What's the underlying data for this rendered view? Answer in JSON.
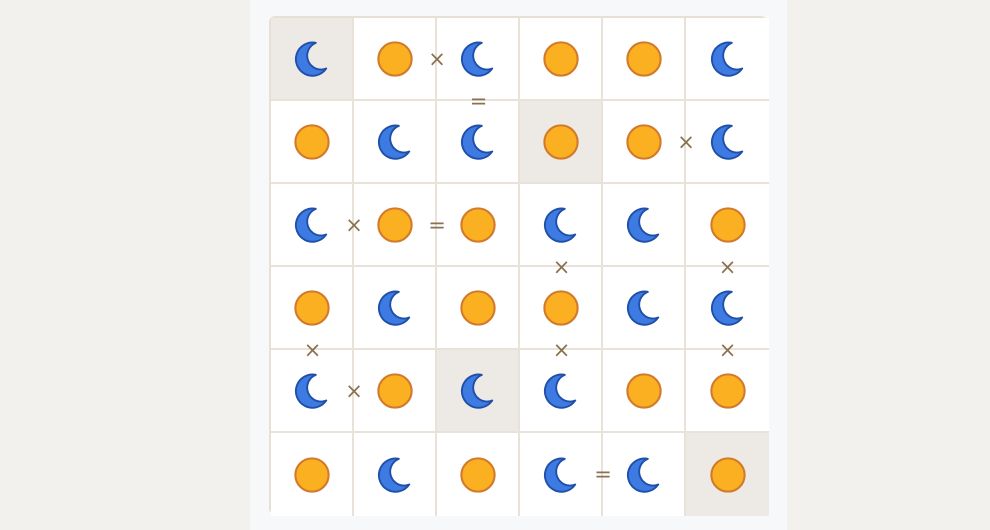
{
  "colors": {
    "sun_fill": "#fbb022",
    "sun_stroke": "#d27a2b",
    "moon_fill": "#3d7be3",
    "moon_stroke": "#1f4fa8",
    "locked_bg": "#ede9e4",
    "constraint": "#8a7150"
  },
  "icons": {
    "sun": "sun-icon",
    "moon": "moon-icon"
  },
  "grid": [
    [
      {
        "v": "moon",
        "locked": true
      },
      {
        "v": "sun",
        "locked": false
      },
      {
        "v": "moon",
        "locked": false
      },
      {
        "v": "sun",
        "locked": false
      },
      {
        "v": "sun",
        "locked": false
      },
      {
        "v": "moon",
        "locked": false
      }
    ],
    [
      {
        "v": "sun",
        "locked": false
      },
      {
        "v": "moon",
        "locked": false
      },
      {
        "v": "moon",
        "locked": false
      },
      {
        "v": "sun",
        "locked": true
      },
      {
        "v": "sun",
        "locked": false
      },
      {
        "v": "moon",
        "locked": false
      }
    ],
    [
      {
        "v": "moon",
        "locked": false
      },
      {
        "v": "sun",
        "locked": false
      },
      {
        "v": "sun",
        "locked": false
      },
      {
        "v": "moon",
        "locked": false
      },
      {
        "v": "moon",
        "locked": false
      },
      {
        "v": "sun",
        "locked": false
      }
    ],
    [
      {
        "v": "sun",
        "locked": false
      },
      {
        "v": "moon",
        "locked": false
      },
      {
        "v": "sun",
        "locked": false
      },
      {
        "v": "sun",
        "locked": false
      },
      {
        "v": "moon",
        "locked": false
      },
      {
        "v": "moon",
        "locked": false
      }
    ],
    [
      {
        "v": "moon",
        "locked": false
      },
      {
        "v": "sun",
        "locked": false
      },
      {
        "v": "moon",
        "locked": true
      },
      {
        "v": "moon",
        "locked": false
      },
      {
        "v": "sun",
        "locked": false
      },
      {
        "v": "sun",
        "locked": false
      }
    ],
    [
      {
        "v": "sun",
        "locked": false
      },
      {
        "v": "moon",
        "locked": false
      },
      {
        "v": "sun",
        "locked": false
      },
      {
        "v": "moon",
        "locked": false
      },
      {
        "v": "moon",
        "locked": false
      },
      {
        "v": "sun",
        "locked": true
      }
    ]
  ],
  "constraints": [
    {
      "r": 0,
      "c": 1,
      "dir": "right",
      "sym": "×"
    },
    {
      "r": 0,
      "c": 2,
      "dir": "down",
      "sym": "="
    },
    {
      "r": 1,
      "c": 4,
      "dir": "right",
      "sym": "×"
    },
    {
      "r": 2,
      "c": 0,
      "dir": "right",
      "sym": "×"
    },
    {
      "r": 2,
      "c": 1,
      "dir": "right",
      "sym": "="
    },
    {
      "r": 2,
      "c": 3,
      "dir": "down",
      "sym": "×"
    },
    {
      "r": 2,
      "c": 5,
      "dir": "down",
      "sym": "×"
    },
    {
      "r": 3,
      "c": 0,
      "dir": "down",
      "sym": "×"
    },
    {
      "r": 3,
      "c": 3,
      "dir": "down",
      "sym": "×"
    },
    {
      "r": 3,
      "c": 5,
      "dir": "down",
      "sym": "×"
    },
    {
      "r": 4,
      "c": 0,
      "dir": "right",
      "sym": "×"
    },
    {
      "r": 5,
      "c": 3,
      "dir": "right",
      "sym": "="
    }
  ]
}
